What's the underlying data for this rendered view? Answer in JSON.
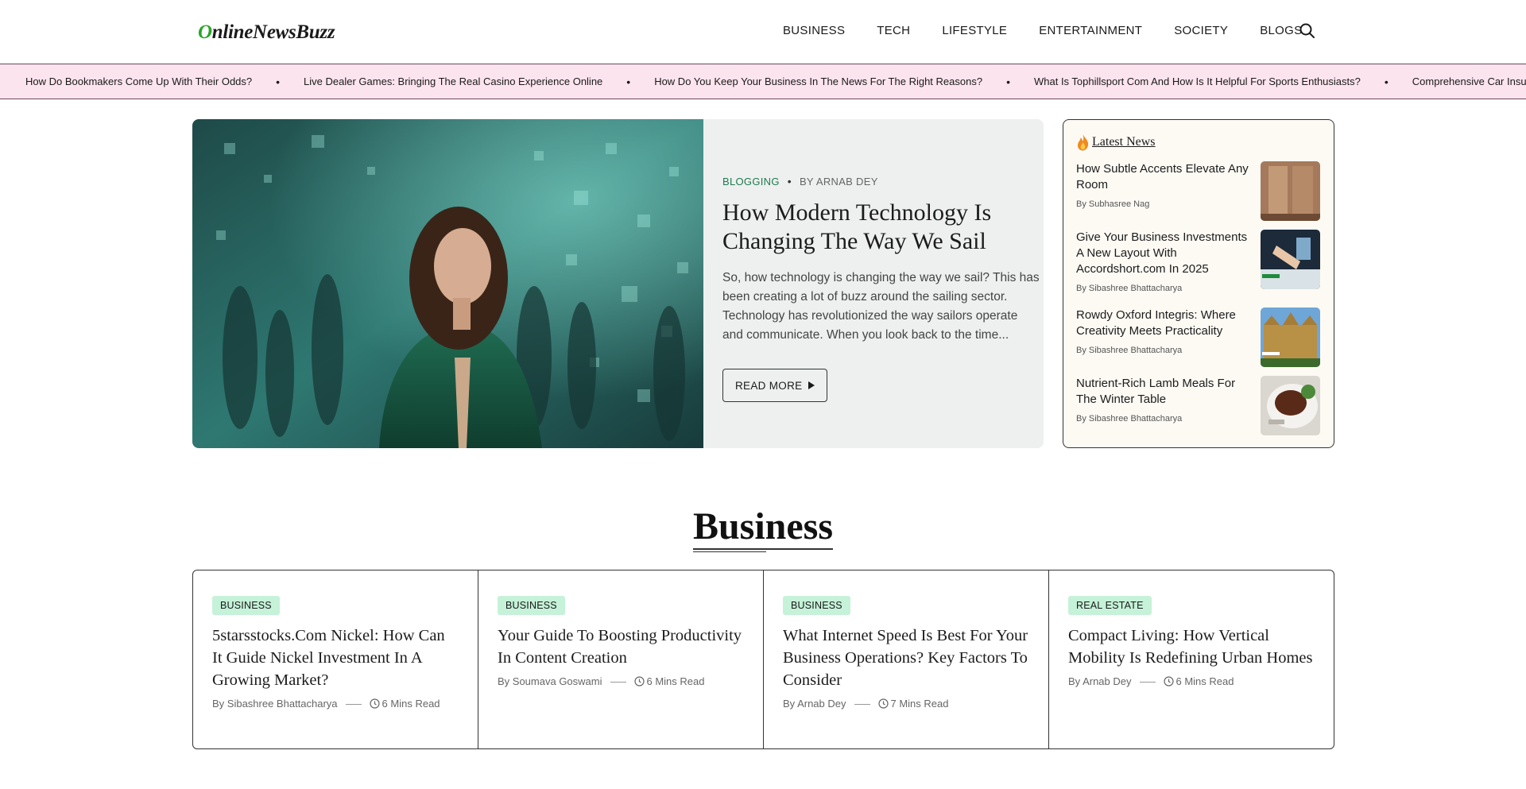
{
  "site": {
    "logo_text": "nlineNewsBuzz",
    "logo_letter": "O"
  },
  "nav": {
    "items": [
      "BUSINESS",
      "TECH",
      "LIFESTYLE",
      "ENTERTAINMENT",
      "SOCIETY",
      "BLOGS"
    ],
    "search_icon": "search-icon"
  },
  "ticker": {
    "items": [
      "How Do Bookmakers Come Up With Their Odds?",
      "Live Dealer Games: Bringing The Real Casino Experience Online",
      "How Do You Keep Your Business In The News For The Right Reasons?",
      "What Is Tophillsport Com And How Is It Helpful For Sports Enthusiasts?",
      "Comprehensive Car Insuran"
    ],
    "separator": "•"
  },
  "hero": {
    "category": "BLOGGING",
    "separator": "•",
    "author": "BY ARNAB DEY",
    "title": "How Modern Technology Is Changing The Way We Sail",
    "excerpt": "So, how technology is changing the way we sail? This has been creating a lot of buzz around the sailing sector. Technology has revolutionized the way sailors operate and communicate. When you look back to the time...",
    "read_more": "READ MORE"
  },
  "latest": {
    "heading": "Latest News",
    "items": [
      {
        "title": "How Subtle Accents Elevate Any Room",
        "author": "By Subhasree Nag"
      },
      {
        "title": "Give Your Business Investments A New Layout With Accordshort.com In 2025",
        "author": "By Sibashree Bhattacharya"
      },
      {
        "title": "Rowdy Oxford Integris: Where Creativity Meets Practicality",
        "author": "By Sibashree Bhattacharya"
      },
      {
        "title": "Nutrient-Rich Lamb Meals For The Winter Table",
        "author": "By Sibashree Bhattacharya"
      }
    ]
  },
  "section": {
    "title": "Business"
  },
  "cards": [
    {
      "badge": "BUSINESS",
      "title": "5starsstocks.Com Nickel: How Can It Guide Nickel Investment In A Growing Market?",
      "author": "By Sibashree Bhattacharya",
      "read_time": "6 Mins Read"
    },
    {
      "badge": "BUSINESS",
      "title": "Your Guide To Boosting Productivity In Content Creation",
      "author": "By Soumava Goswami",
      "read_time": "6 Mins Read"
    },
    {
      "badge": "BUSINESS",
      "title": "What Internet Speed Is Best For Your Business Operations? Key Factors To Consider",
      "author": "By Arnab Dey",
      "read_time": "7 Mins Read"
    },
    {
      "badge": "REAL ESTATE",
      "title": "Compact Living: How Vertical Mobility Is Redefining Urban Homes",
      "author": "By Arnab Dey",
      "read_time": "6 Mins Read"
    }
  ]
}
